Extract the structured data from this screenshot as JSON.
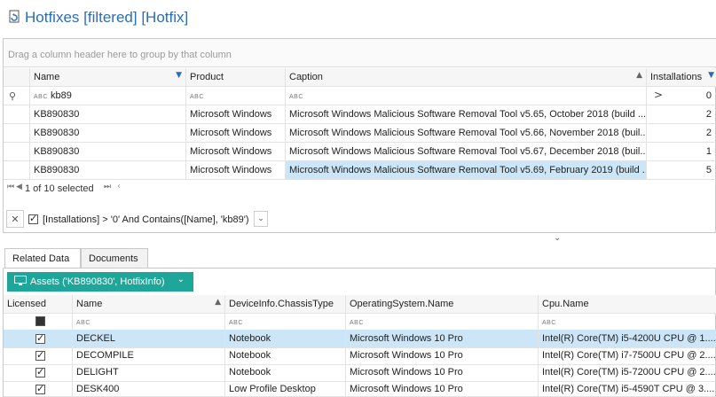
{
  "window": {
    "title": "Hotfixes [filtered] [Hotfix]",
    "accent": "#2a6ebb",
    "title_icon": "refresh-document-icon"
  },
  "group_panel": {
    "hint": "Drag a column header here to group by that column"
  },
  "hotfix_grid": {
    "columns": [
      {
        "label": "Name"
      },
      {
        "label": "Product"
      },
      {
        "label": "Caption"
      },
      {
        "label": "Installations"
      }
    ],
    "filter_row": {
      "name": "kb89",
      "installations": "0"
    },
    "rows": [
      {
        "name": "KB890830",
        "product": "Microsoft Windows",
        "caption": "Microsoft Windows Malicious Software Removal Tool v5.65, October 2018 (build ...",
        "installations": "2"
      },
      {
        "name": "KB890830",
        "product": "Microsoft Windows",
        "caption": "Microsoft Windows Malicious Software Removal Tool v5.66, November 2018 (buil...",
        "installations": "2"
      },
      {
        "name": "KB890830",
        "product": "Microsoft Windows",
        "caption": "Microsoft Windows Malicious Software Removal Tool v5.67, December 2018 (buil...",
        "installations": "1"
      },
      {
        "name": "KB890830",
        "product": "Microsoft Windows",
        "caption": "Microsoft Windows Malicious Software Removal Tool v5.69, February 2019 (build ...",
        "installations": "5"
      }
    ],
    "pager": {
      "status": "1 of 10 selected"
    },
    "filter_expression": "[Installations] > '0' And Contains([Name], 'kb89')"
  },
  "tabs": [
    {
      "label": "Related Data"
    },
    {
      "label": "Documents"
    }
  ],
  "assets": {
    "header_label": "Assets ('KB890830', HotfixInfo)",
    "accent": "#1fa69a",
    "columns": [
      {
        "label": "Licensed"
      },
      {
        "label": "Name"
      },
      {
        "label": "DeviceInfo.ChassisType"
      },
      {
        "label": "OperatingSystem.Name"
      },
      {
        "label": "Cpu.Name"
      }
    ],
    "rows": [
      {
        "licensed": true,
        "name": "DECKEL",
        "chassis": "Notebook",
        "os": "Microsoft Windows 10 Pro",
        "cpu": "Intel(R) Core(TM) i5-4200U CPU @ 1...."
      },
      {
        "licensed": true,
        "name": "DECOMPILE",
        "chassis": "Notebook",
        "os": "Microsoft Windows 10 Pro",
        "cpu": "Intel(R) Core(TM) i7-7500U CPU @ 2...."
      },
      {
        "licensed": true,
        "name": "DELIGHT",
        "chassis": "Notebook",
        "os": "Microsoft Windows 10 Pro",
        "cpu": "Intel(R) Core(TM) i5-7200U CPU @ 2...."
      },
      {
        "licensed": true,
        "name": "DESK400",
        "chassis": "Low Profile Desktop",
        "os": "Microsoft Windows 10 Pro",
        "cpu": "Intel(R) Core(TM) i5-4590T CPU @ 3...."
      }
    ],
    "selected_color": "#cce6f7"
  }
}
